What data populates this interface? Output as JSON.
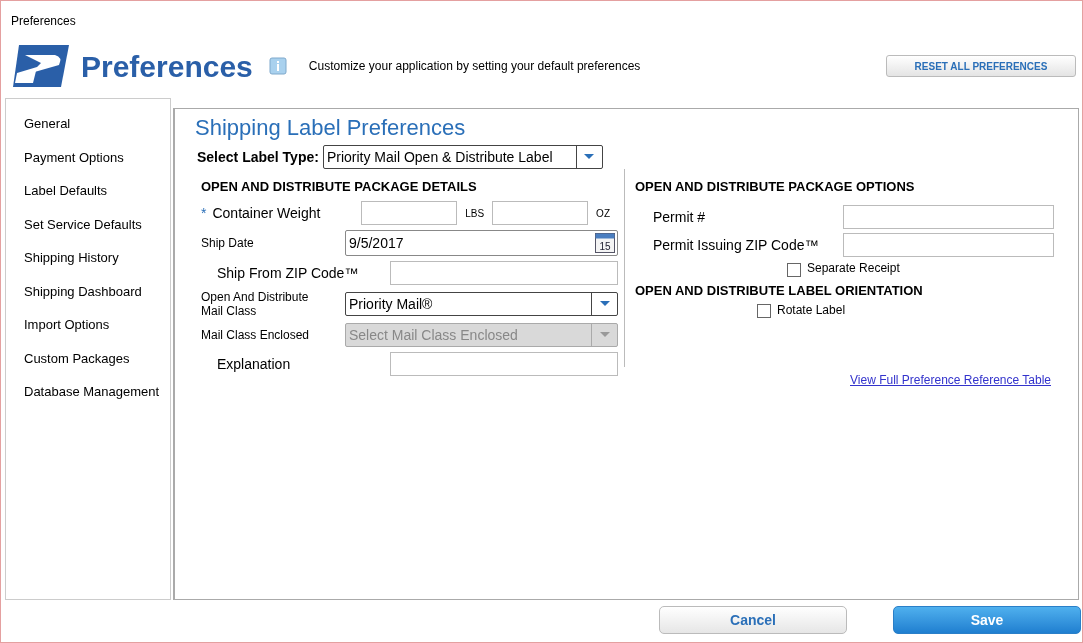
{
  "window": {
    "title": "Preferences"
  },
  "header": {
    "title": "Preferences",
    "subtitle": "Customize your application by setting your default preferences",
    "reset_button": "RESET ALL PREFERENCES"
  },
  "sidebar": {
    "items": [
      {
        "label": "General"
      },
      {
        "label": "Payment Options"
      },
      {
        "label": "Label Defaults"
      },
      {
        "label": "Set Service Defaults"
      },
      {
        "label": "Shipping History"
      },
      {
        "label": "Shipping Dashboard"
      },
      {
        "label": "Import Options"
      },
      {
        "label": "Custom Packages"
      },
      {
        "label": "Database Management"
      }
    ]
  },
  "panel": {
    "title": "Shipping Label Preferences",
    "label_type": {
      "label": "Select Label Type:",
      "value": "Priority Mail Open & Distribute Label"
    },
    "details": {
      "heading": "OPEN AND DISTRIBUTE PACKAGE DETAILS",
      "fields": [
        {
          "kind": "weight",
          "label": "Container Weight",
          "required_mark": "*",
          "units": [
            "LBS",
            "OZ"
          ]
        },
        {
          "kind": "date",
          "label": "Ship Date",
          "value": "9/5/2017",
          "calendar_day": "15"
        },
        {
          "kind": "text",
          "label": "Ship From ZIP Code™"
        },
        {
          "kind": "select",
          "label": "Open And Distribute Mail Class",
          "value": "Priority Mail®",
          "disabled": false
        },
        {
          "kind": "select",
          "label": "Mail Class Enclosed",
          "placeholder": "Select Mail Class Enclosed",
          "disabled": true
        },
        {
          "kind": "text",
          "label": "Explanation"
        }
      ]
    },
    "options": {
      "heading": "OPEN AND DISTRIBUTE PACKAGE OPTIONS",
      "fields": [
        {
          "label": "Permit #"
        },
        {
          "label": "Permit Issuing ZIP Code™"
        }
      ],
      "checkbox": {
        "label": "Separate Receipt",
        "checked": false
      }
    },
    "orientation": {
      "heading": "OPEN AND DISTRIBUTE LABEL ORIENTATION",
      "checkbox": {
        "label": "Rotate Label",
        "checked": false
      }
    },
    "link": "View Full Preference Reference Table"
  },
  "footer": {
    "buttons": [
      {
        "kind": "secondary",
        "label": "Cancel"
      },
      {
        "kind": "primary",
        "label": "Save"
      }
    ]
  }
}
